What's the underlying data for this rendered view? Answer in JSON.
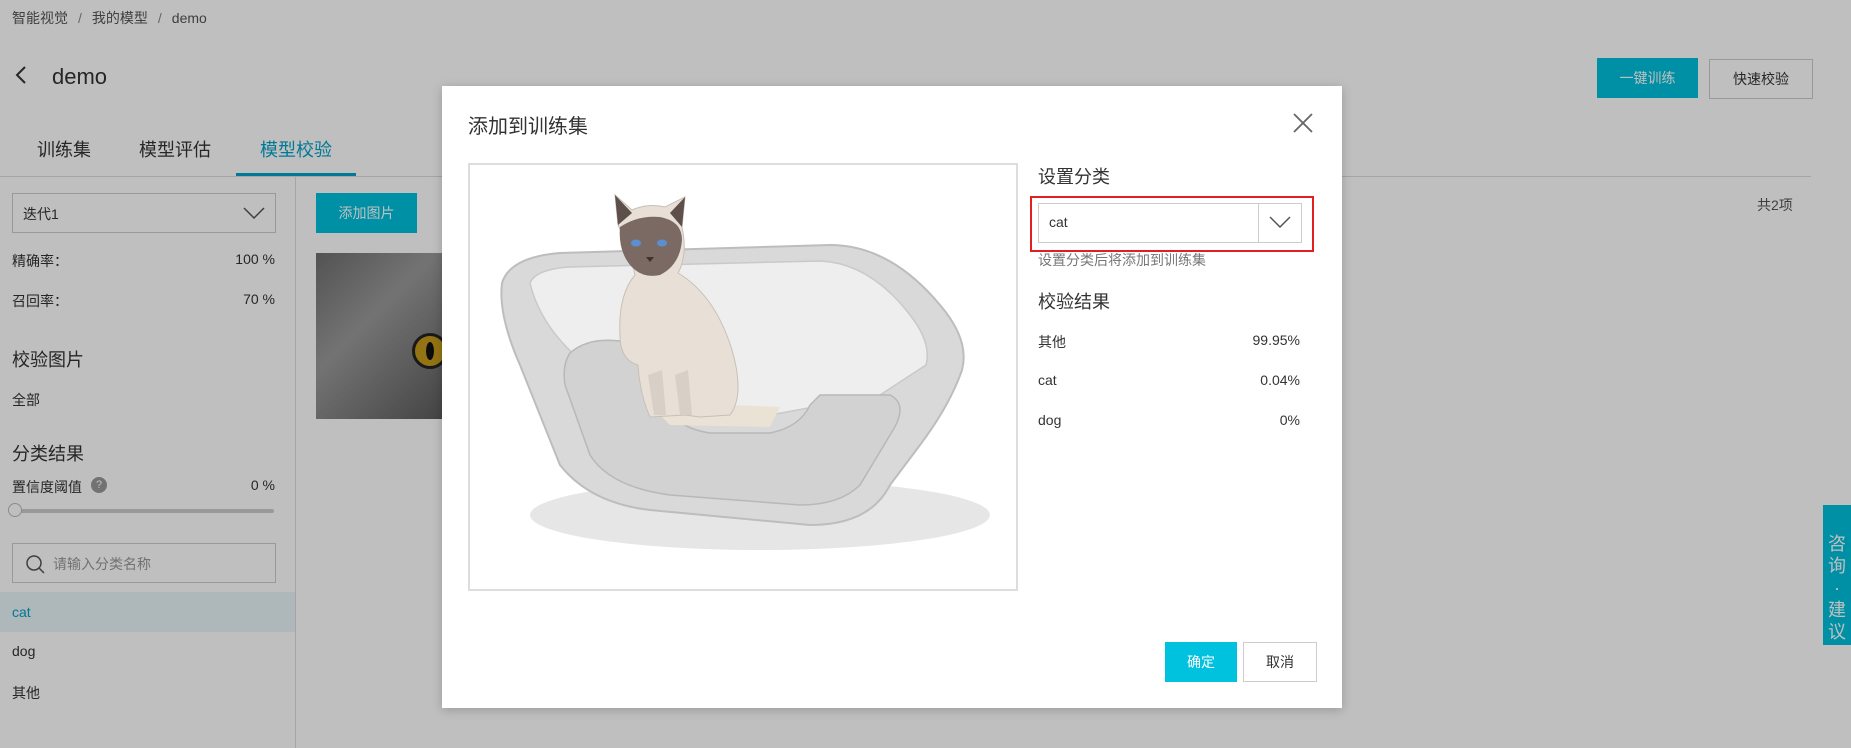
{
  "breadcrumb": [
    "智能视觉",
    "我的模型",
    "demo"
  ],
  "page": {
    "title": "demo"
  },
  "header_buttons": {
    "train": "一键训练",
    "quick_check": "快速校验"
  },
  "tabs": [
    {
      "label": "训练集",
      "active": false
    },
    {
      "label": "模型评估",
      "active": false
    },
    {
      "label": "模型校验",
      "active": true
    }
  ],
  "sidebar": {
    "iteration": "迭代1",
    "precision_label": "精确率：",
    "precision_value": "100 %",
    "recall_label": "召回率：",
    "recall_value": "70 %",
    "check_images_title": "校验图片",
    "all_label": "全部",
    "classify_title": "分类结果",
    "threshold_label": "置信度阈值",
    "threshold_value": "0 %",
    "search_placeholder": "请输入分类名称",
    "classes": [
      "cat",
      "dog",
      "其他"
    ]
  },
  "main": {
    "add_image": "添加图片",
    "total": "共2项"
  },
  "consult": {
    "text": "咨询·建议"
  },
  "modal": {
    "title": "添加到训练集",
    "set_class_title": "设置分类",
    "selected_class": "cat",
    "hint": "设置分类后将添加到训练集",
    "result_title": "校验结果",
    "results": [
      {
        "label": "其他",
        "value": "99.95%"
      },
      {
        "label": "cat",
        "value": "0.04%"
      },
      {
        "label": "dog",
        "value": "0%"
      }
    ],
    "ok": "确定",
    "cancel": "取消"
  },
  "colors": {
    "primary": "#00c1de",
    "highlight": "#e02020",
    "active_tab": "#00a2c9"
  }
}
